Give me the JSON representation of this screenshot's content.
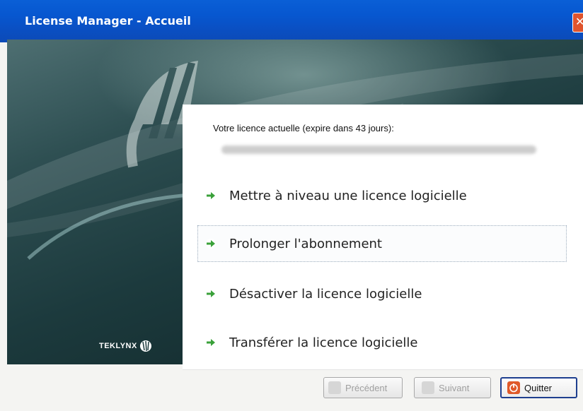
{
  "window": {
    "title": "License Manager - Accueil"
  },
  "license": {
    "heading": "Votre licence actuelle (expire dans 43 jours):",
    "blurred_value": ""
  },
  "actions": [
    {
      "label": "Mettre à niveau une licence logicielle",
      "selected": false
    },
    {
      "label": "Prolonger l'abonnement",
      "selected": true
    },
    {
      "label": "Désactiver la licence logicielle",
      "selected": false
    },
    {
      "label": "Transférer la licence logicielle",
      "selected": false
    }
  ],
  "brand": {
    "logo_text": "TEKLYNX"
  },
  "buttons": {
    "previous": "Précédent",
    "next": "Suivant",
    "quit": "Quitter"
  },
  "colors": {
    "titlebar": "#0757d0",
    "arrow": "#3aa13a",
    "quit_icon": "#e05a2a"
  }
}
